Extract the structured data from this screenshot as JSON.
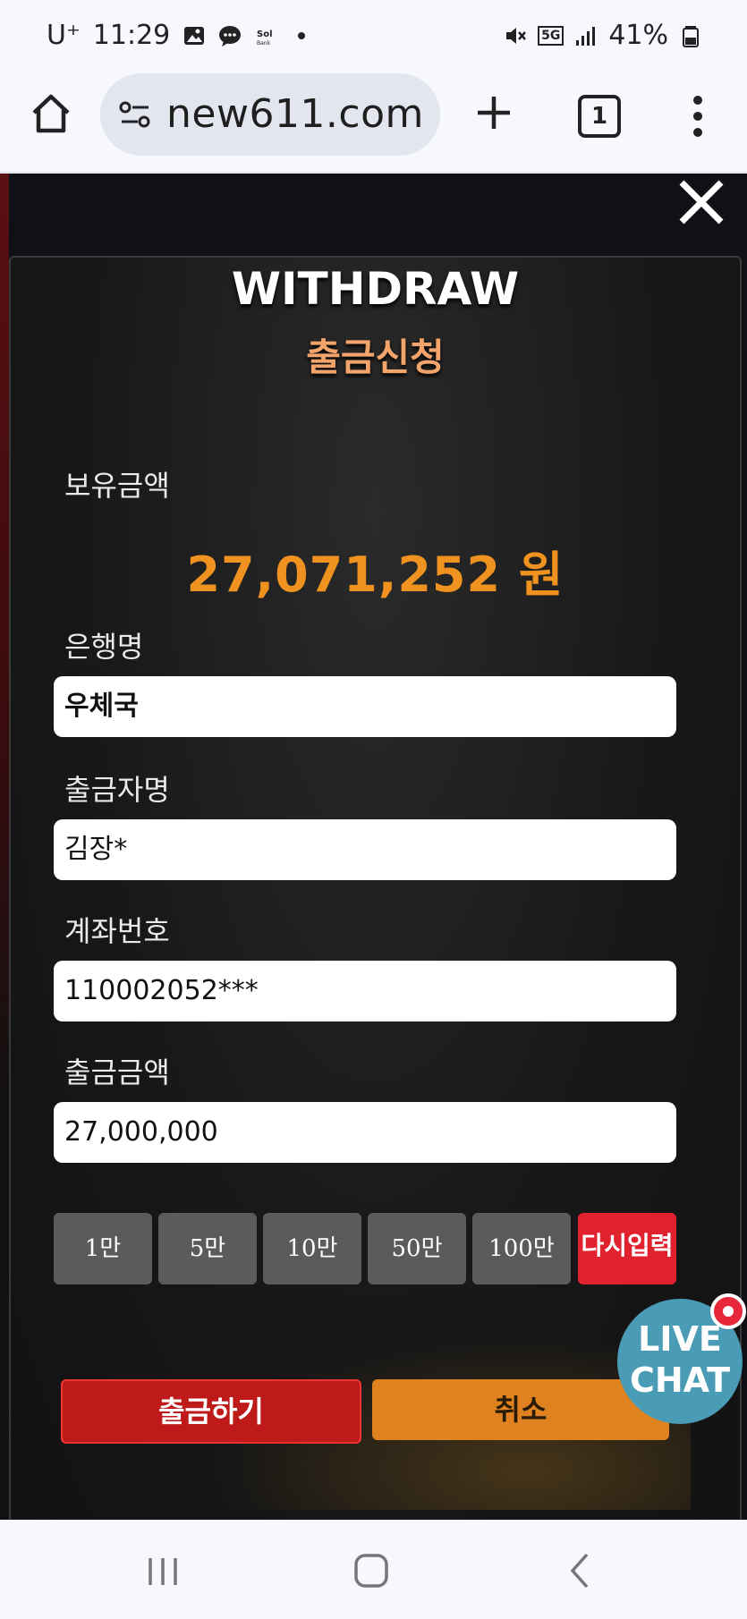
{
  "status_bar": {
    "carrier": "U⁺",
    "time": "11:29",
    "network": "5G",
    "battery": "41%"
  },
  "browser": {
    "url": "new611.com",
    "tab_count": "1"
  },
  "modal": {
    "title_en": "WITHDRAW",
    "title_ko": "출금신청",
    "balance_label": "보유금액",
    "balance_value": "27,071,252 원",
    "bank_label": "은행명",
    "bank_value": "우체국",
    "holder_label": "출금자명",
    "holder_value": "김장*",
    "account_label": "계좌번호",
    "account_value": "110002052***",
    "amount_label": "출금금액",
    "amount_value": "27,000,000",
    "quick_amounts": [
      "1만",
      "5만",
      "10만",
      "50만",
      "100만"
    ],
    "reset_label": "다시입력",
    "submit_label": "출금하기",
    "cancel_label": "취소"
  },
  "live_chat": {
    "line1": "LIVE",
    "line2": "CHAT"
  },
  "colors": {
    "accent_orange": "#f0921f",
    "submit_red": "#bf1a1a",
    "reset_red": "#e0222f",
    "cancel_orange": "#e0821f"
  }
}
